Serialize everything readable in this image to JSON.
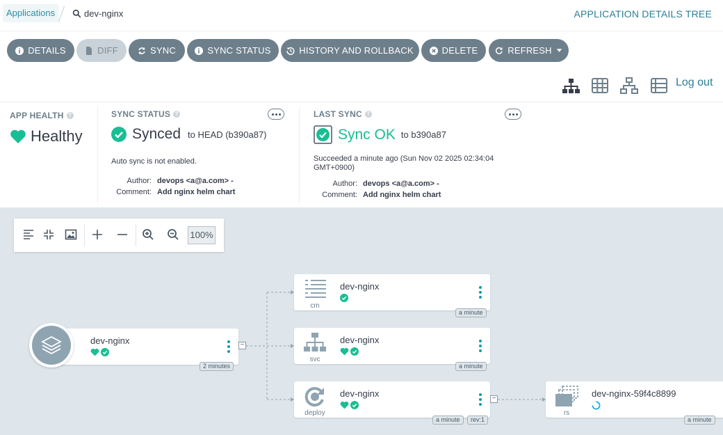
{
  "breadcrumb": {
    "root": "Applications",
    "current": "dev-nginx"
  },
  "page_title": "APPLICATION DETAILS TREE",
  "toolbar": {
    "details": "DETAILS",
    "diff": "DIFF",
    "sync": "SYNC",
    "sync_status": "SYNC STATUS",
    "history": "HISTORY AND ROLLBACK",
    "delete": "DELETE",
    "refresh": "REFRESH"
  },
  "view_icons": [
    "tree-view-icon",
    "pods-view-icon",
    "network-view-icon",
    "list-view-icon"
  ],
  "logout": "Log out",
  "app_health": {
    "label": "APP HEALTH",
    "value": "Healthy"
  },
  "sync_status": {
    "label": "SYNC STATUS",
    "value": "Synced",
    "target": "to HEAD (b390a87)",
    "auto_sync": "Auto sync is not enabled.",
    "author_key": "Author:",
    "author": "devops <a@a.com> -",
    "comment_key": "Comment:",
    "comment": "Add nginx helm chart"
  },
  "last_sync": {
    "label": "LAST SYNC",
    "value": "Sync OK",
    "target": "to b390a87",
    "succeeded_line1": "Succeeded a minute ago (Sun Nov 02 2025 02:34:04",
    "succeeded_line2": "GMT+0900)",
    "author_key": "Author:",
    "author": "devops <a@a.com> -",
    "comment_key": "Comment:",
    "comment": "Add nginx helm chart"
  },
  "zoom": {
    "level": "100%"
  },
  "nodes": {
    "app": {
      "name": "dev-nginx",
      "age": "2 minutes"
    },
    "cm": {
      "name": "dev-nginx",
      "kind": "cm",
      "age": "a minute"
    },
    "svc": {
      "name": "dev-nginx",
      "kind": "svc",
      "age": "a minute"
    },
    "deploy": {
      "name": "dev-nginx",
      "kind": "deploy",
      "age": "a minute",
      "rev": "rev:1"
    },
    "rs": {
      "name": "dev-nginx-59f4c8899",
      "kind": "rs",
      "age": "a minute"
    }
  },
  "colors": {
    "accent": "#2e7d95",
    "healthy": "#18be94",
    "button": "#6d7f8b",
    "canvas": "#dee6eb"
  }
}
